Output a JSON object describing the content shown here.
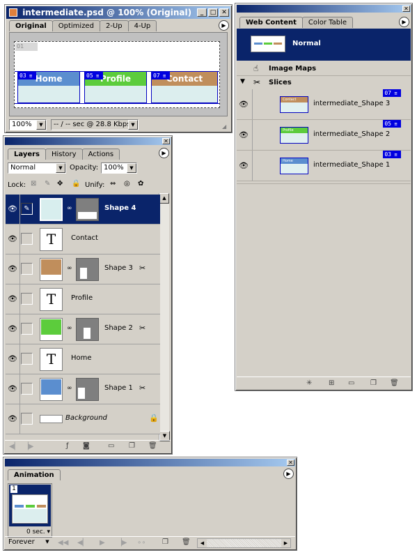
{
  "colors": {
    "title_gradient_start": "#0a246a",
    "title_gradient_end": "#a6caf0",
    "panel_bg": "#d4d0c8",
    "home_nav": "#5b8ecf",
    "profile_nav": "#5ccc3c",
    "contact_nav": "#c08e5c",
    "slice_badge": "#0000e0",
    "selected_row": "#0a246a"
  },
  "document": {
    "title": "intermediate.psd @ 100% (Original)",
    "tabs": [
      "Original",
      "Optimized",
      "2-Up",
      "4-Up"
    ],
    "active_tab": "Original",
    "zoom": "100%",
    "download_info": "-- / -- sec @ 28.8 Kbps",
    "canvas_auto_slice": "01",
    "nav": [
      {
        "label": "Home",
        "slice": "03"
      },
      {
        "label": "Profile",
        "slice": "05"
      },
      {
        "label": "Contact",
        "slice": "07"
      }
    ]
  },
  "web_content": {
    "tabs": [
      "Web Content",
      "Color Table"
    ],
    "active_tab": "Web Content",
    "state_label": "Normal",
    "image_maps_label": "Image Maps",
    "slices_label": "Slices",
    "slices": [
      {
        "name": "intermediate_Shape 3",
        "badge": "07",
        "thumb_label": "Contact",
        "color": "#c08e5c"
      },
      {
        "name": "intermediate_Shape 2",
        "badge": "05",
        "thumb_label": "Profile",
        "color": "#5ccc3c"
      },
      {
        "name": "intermediate_Shape 1",
        "badge": "03",
        "thumb_label": "Home",
        "color": "#5b8ecf"
      }
    ],
    "bottom_icons": [
      "new-rollover-icon",
      "new-image-map-icon",
      "new-folder-icon",
      "new-state-icon",
      "trash-icon"
    ]
  },
  "layers": {
    "tabs": [
      "Layers",
      "History",
      "Actions"
    ],
    "active_tab": "Layers",
    "blend_mode": "Normal",
    "opacity_label": "Opacity:",
    "opacity_value": "100%",
    "lock_label": "Lock:",
    "unify_label": "Unify:",
    "items": [
      {
        "name": "Shape 4",
        "type": "shape",
        "color": "#d8eeee",
        "selected": true
      },
      {
        "name": "Contact",
        "type": "text",
        "selected": false
      },
      {
        "name": "Shape 3",
        "type": "shape",
        "color": "#c08e5c",
        "selected": false
      },
      {
        "name": "Profile",
        "type": "text",
        "selected": false
      },
      {
        "name": "Shape 2",
        "type": "shape",
        "color": "#5ccc3c",
        "selected": false
      },
      {
        "name": "Home",
        "type": "text",
        "selected": false
      },
      {
        "name": "Shape 1",
        "type": "shape",
        "color": "#5b8ecf",
        "selected": false
      },
      {
        "name": "Background",
        "type": "background",
        "selected": false
      }
    ]
  },
  "animation": {
    "tab": "Animation",
    "frame_number": "1",
    "frame_delay": "0 sec.",
    "loop": "Forever"
  }
}
